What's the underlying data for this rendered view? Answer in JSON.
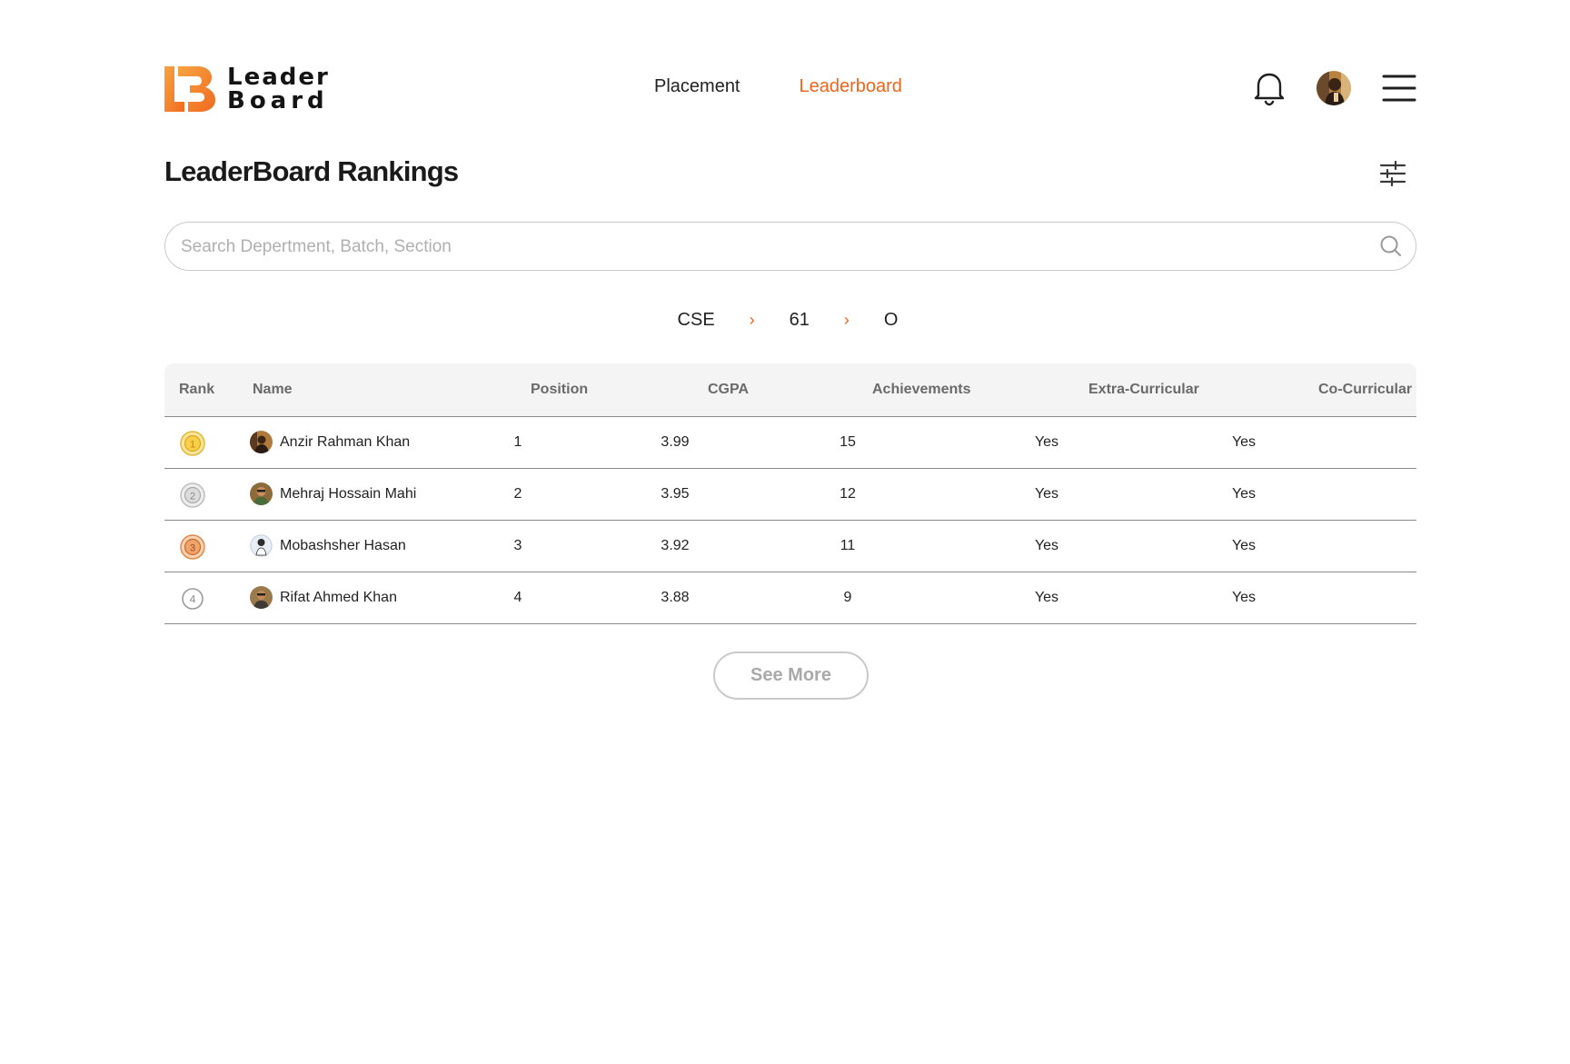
{
  "brand": {
    "line1": "Leader",
    "line2": "Board",
    "accent": "#f0641c"
  },
  "nav": {
    "items": [
      {
        "label": "Placement",
        "active": false
      },
      {
        "label": "Leaderboard",
        "active": true
      }
    ]
  },
  "header_icons": [
    "bell-icon",
    "avatar",
    "hamburger-menu-icon"
  ],
  "page": {
    "title": "LeaderBoard Rankings"
  },
  "search": {
    "placeholder": "Search Depertment, Batch, Section",
    "value": ""
  },
  "breadcrumb": [
    "CSE",
    "61",
    "O"
  ],
  "table": {
    "columns": [
      "Rank",
      "Name",
      "Position",
      "CGPA",
      "Achievements",
      "Extra-Curricular",
      "Co-Curricular"
    ],
    "rows": [
      {
        "rank": "1",
        "medal": "gold",
        "name": "Anzir Rahman Khan",
        "position": "1",
        "cgpa": "3.99",
        "achievements": "15",
        "extra": "Yes",
        "co": "Yes"
      },
      {
        "rank": "2",
        "medal": "silver",
        "name": "Mehraj Hossain Mahi",
        "position": "2",
        "cgpa": "3.95",
        "achievements": "12",
        "extra": "Yes",
        "co": "Yes"
      },
      {
        "rank": "3",
        "medal": "bronze",
        "name": "Mobashsher Hasan",
        "position": "3",
        "cgpa": "3.92",
        "achievements": "11",
        "extra": "Yes",
        "co": "Yes"
      },
      {
        "rank": "4",
        "medal": "plain",
        "name": "Rifat Ahmed Khan",
        "position": "4",
        "cgpa": "3.88",
        "achievements": "9",
        "extra": "Yes",
        "co": "Yes"
      }
    ]
  },
  "see_more": {
    "label": "See More"
  }
}
